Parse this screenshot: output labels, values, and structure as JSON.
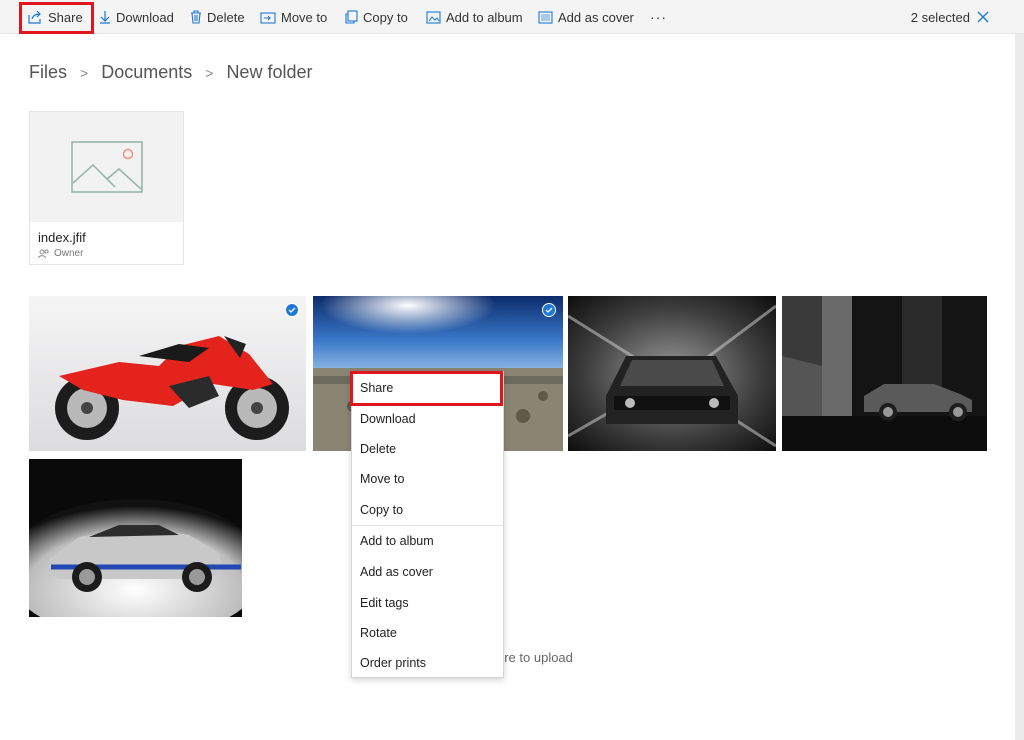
{
  "toolbar": {
    "share": "Share",
    "download": "Download",
    "delete": "Delete",
    "move_to": "Move to",
    "copy_to": "Copy to",
    "add_to_album": "Add to album",
    "add_as_cover": "Add as cover",
    "more": "···",
    "selected_count": "2 selected"
  },
  "breadcrumb": {
    "items": [
      "Files",
      "Documents",
      "New folder"
    ],
    "separator": ">"
  },
  "file": {
    "name": "index.jfif",
    "owner": "Owner"
  },
  "photos": [
    {
      "name": "red-motorcycle",
      "selected": true
    },
    {
      "name": "desert-road-sky",
      "selected": true
    },
    {
      "name": "dark-muscle-car-front",
      "selected": false
    },
    {
      "name": "dark-muscle-car-side",
      "selected": false
    },
    {
      "name": "silver-shelby-mustang",
      "selected": false
    }
  ],
  "context_menu": {
    "items": [
      "Share",
      "Download",
      "Delete",
      "Move to",
      "Copy to",
      "Add to album",
      "Add as cover",
      "Edit tags",
      "Rotate",
      "Order prints"
    ]
  },
  "upload_hint": "ere to upload",
  "colors": {
    "accent": "#1e78d7",
    "highlight": "#e0151d",
    "toolbar_bg": "#f4f4f4"
  }
}
